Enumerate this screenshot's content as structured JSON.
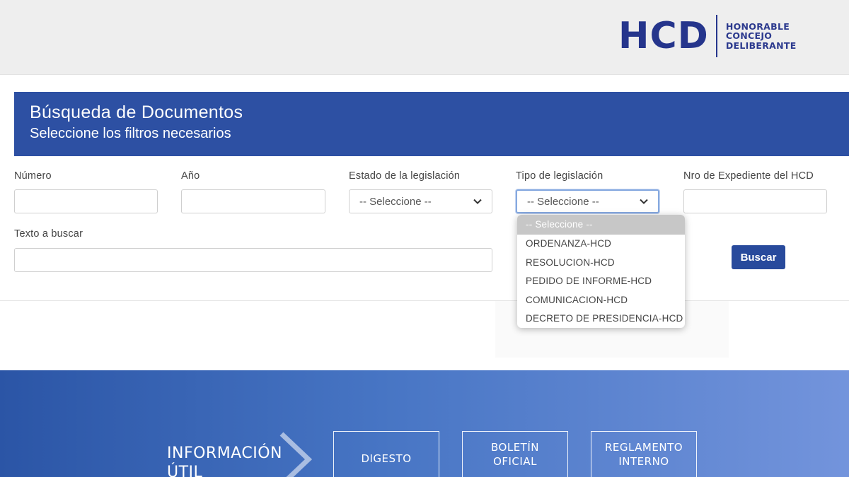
{
  "header": {
    "logo_mark": "HCD",
    "logo_lines": [
      "HONORABLE",
      "CONCEJO",
      "DELIBERANTE"
    ]
  },
  "search": {
    "title": "Búsqueda de Documentos",
    "subtitle": "Seleccione los filtros necesarios",
    "fields": {
      "numero_label": "Número",
      "anio_label": "Año",
      "estado_label": "Estado de la legislación",
      "estado_value": "-- Seleccione --",
      "tipo_label": "Tipo de legislación",
      "tipo_value": "-- Seleccione --",
      "expediente_label": "Nro de Expediente del HCD",
      "texto_label": "Texto a buscar"
    },
    "buscar_label": "Buscar",
    "tipo_options": [
      "-- Seleccione --",
      "ORDENANZA-HCD",
      "RESOLUCION-HCD",
      "PEDIDO DE INFORME-HCD",
      "COMUNICACION-HCD",
      "DECRETO DE PRESIDENCIA-HCD"
    ]
  },
  "footer": {
    "info_line1": "INFORMACIÓN",
    "info_line2": "ÚTIL",
    "boxes": [
      {
        "line1": "DIGESTO",
        "line2": ""
      },
      {
        "line1": "BOLETÍN",
        "line2": "OFICIAL"
      },
      {
        "line1": "REGLAMENTO",
        "line2": "INTERNO"
      }
    ]
  },
  "colors": {
    "brand_blue": "#2d50a3",
    "button_blue": "#284a9c",
    "logo_blue": "#25358c"
  }
}
